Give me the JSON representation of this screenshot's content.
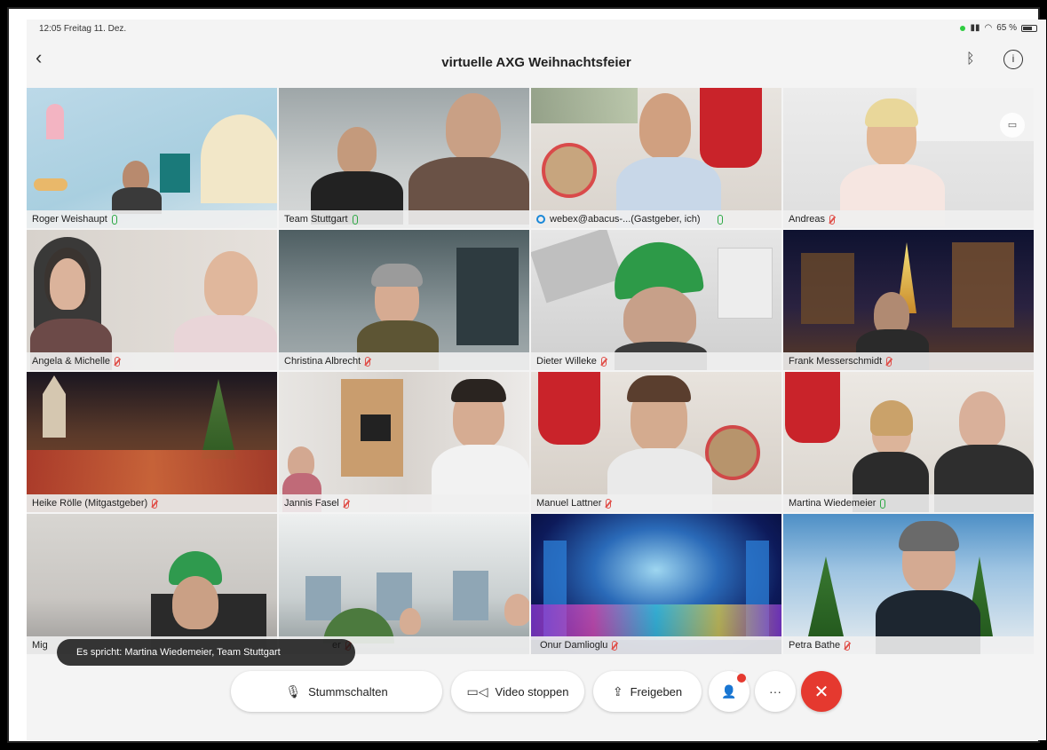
{
  "status": {
    "time": "12:05",
    "date": "Freitag 11. Dez.",
    "battery": "65 %"
  },
  "meeting": {
    "title": "virtuelle AXG Weihnachtsfeier"
  },
  "participants": [
    {
      "name": "Roger Weishaupt",
      "mic": "on"
    },
    {
      "name": "Team Stuttgart",
      "mic": "on"
    },
    {
      "name": "webex@abacus-...(Gastgeber, ich)",
      "mic": "on"
    },
    {
      "name": "Andreas",
      "mic": "off"
    },
    {
      "name": "Angela & Michelle",
      "mic": "off"
    },
    {
      "name": "Christina Albrecht",
      "mic": "off"
    },
    {
      "name": "Dieter Willeke",
      "mic": "off"
    },
    {
      "name": "Frank Messerschmidt",
      "mic": "off"
    },
    {
      "name": "Heike Rölle (Mitgastgeber)",
      "mic": "off"
    },
    {
      "name": "Jannis Fasel",
      "mic": "off"
    },
    {
      "name": "Manuel Lattner",
      "mic": "off"
    },
    {
      "name": "Martina Wiedemeier",
      "mic": "on"
    },
    {
      "name": "Mig",
      "mic": "off"
    },
    {
      "name": "er",
      "mic": "off"
    },
    {
      "name": "Onur Damlioglu",
      "mic": "off"
    },
    {
      "name": "Petra Bathe",
      "mic": "off"
    }
  ],
  "speaking": "Es spricht: Martina Wiedemeier, Team Stuttgart",
  "controls": {
    "mute": "Stummschalten",
    "video": "Video stoppen",
    "share": "Freigeben",
    "more": "···",
    "end": "✕"
  },
  "colors": {
    "accent": "#34a3c6",
    "end": "#e5392f",
    "mic_on": "#2aa842",
    "mic_off": "#e0504a"
  }
}
